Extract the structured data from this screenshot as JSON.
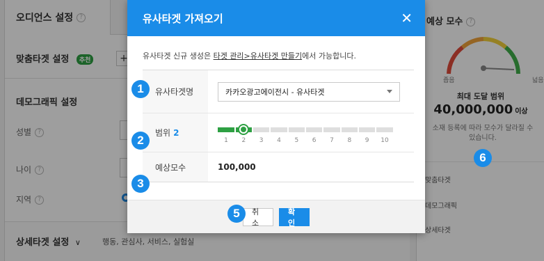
{
  "background": {
    "tab_label": "오디언스 설정",
    "custom_target": {
      "label": "맞춤타겟 설정",
      "badge": "추천",
      "plus": "+"
    },
    "demographic_title": "데모그래픽 설정",
    "gender_label": "성별",
    "age_label": "나이",
    "region_label": "지역",
    "detail_target": {
      "label": "상세타겟 설정",
      "chevron": "∨",
      "subtitle": "행동, 관심사, 서비스, 실험실"
    },
    "help_glyph": "?"
  },
  "right_panel": {
    "title": "예상 모수",
    "gauge_low": "좁음",
    "gauge_high": "넓음",
    "range_label": "최대 도달 범위",
    "range_value": "40,000,000",
    "range_suffix": "이상",
    "note": "소재 등록에 따라 모수가 달라질 수 있습니다.",
    "sections": [
      "맞춤타겟",
      "데모그래픽",
      "상세타겟"
    ]
  },
  "modal": {
    "title": "유사타겟 가져오기",
    "close_glyph": "✕",
    "description_prefix": "유사타겟 신규 생성은 ",
    "description_link": "타겟 관리>유사타겟 만들기",
    "description_suffix": "에서 가능합니다.",
    "fields": {
      "name_label": "유사타겟명",
      "name_value": "카카오광고에이전시 - 유사타겟",
      "range_label": "범위",
      "range_value": "2",
      "range_ticks": [
        "1",
        "2",
        "3",
        "4",
        "5",
        "6",
        "7",
        "8",
        "9",
        "10"
      ],
      "estimate_label": "예상모수",
      "estimate_value": "100,000"
    },
    "cancel_label": "취소",
    "confirm_label": "확인"
  },
  "slider": {
    "selected": 2,
    "min": 1,
    "max": 10
  },
  "callouts": [
    "1",
    "2",
    "3",
    "5",
    "6"
  ],
  "colors": {
    "accent": "#1a8ce8",
    "slider_active": "#2ea043",
    "slider_inactive": "#dedede"
  }
}
